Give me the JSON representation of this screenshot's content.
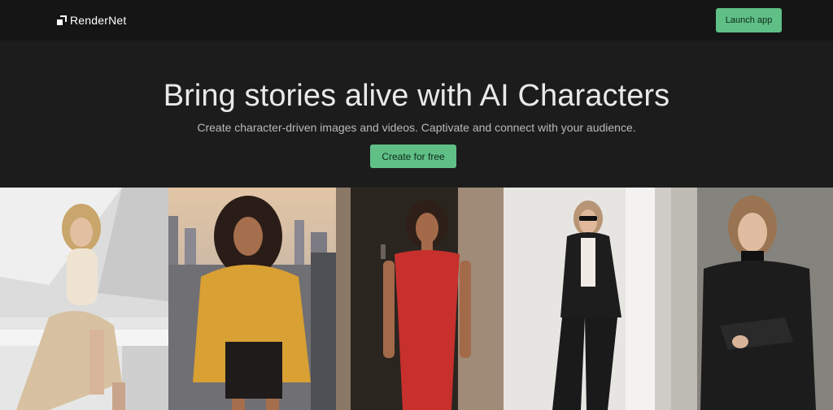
{
  "nav": {
    "brand": "RenderNet",
    "launch_label": "Launch app"
  },
  "hero": {
    "title": "Bring stories alive with AI Characters",
    "subtitle": "Create character-driven images and videos. Captivate and connect with your audience.",
    "cta_label": "Create for free"
  },
  "colors": {
    "accent": "#5fbf86",
    "background": "#1a1a1a"
  },
  "gallery": {
    "images": [
      "woman-cream-knit-sitting",
      "woman-mustard-sweater-city",
      "woman-red-dress-doorway",
      "woman-black-suit-sunglasses",
      "woman-leather-jacket-wall"
    ]
  }
}
